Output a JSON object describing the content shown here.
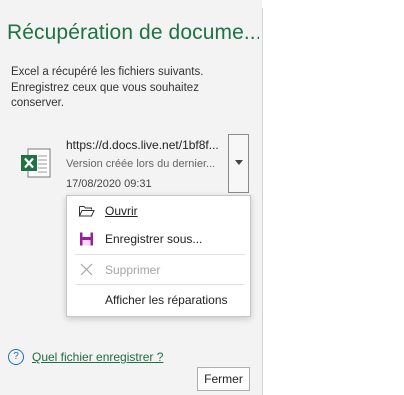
{
  "pane": {
    "title": "Récupération de docume...",
    "description": "Excel a récupéré les fichiers suivants. Enregistrez ceux que vous souhaitez conserver."
  },
  "file": {
    "url": "https://d.docs.live.net/1bf8f...",
    "version": "Version créée lors du dernier...",
    "date": "17/08/2020 09:31",
    "icon": "excel-file-icon"
  },
  "menu": {
    "items": [
      {
        "label": "Ouvrir",
        "icon": "open-folder-icon",
        "disabled": false
      },
      {
        "label": "Enregistrer sous...",
        "icon": "save-icon",
        "disabled": false
      },
      {
        "label": "Supprimer",
        "icon": "delete-x-icon",
        "disabled": true
      },
      {
        "label": "Afficher les réparations",
        "icon": "",
        "disabled": false
      }
    ]
  },
  "help": {
    "link": "Quel fichier enregistrer ?",
    "icon": "help-circle-icon"
  },
  "buttons": {
    "close": "Fermer"
  },
  "colors": {
    "accent": "#1f7244",
    "pane_background": "#f3f3f3",
    "save_icon": "#9b1f9b"
  }
}
